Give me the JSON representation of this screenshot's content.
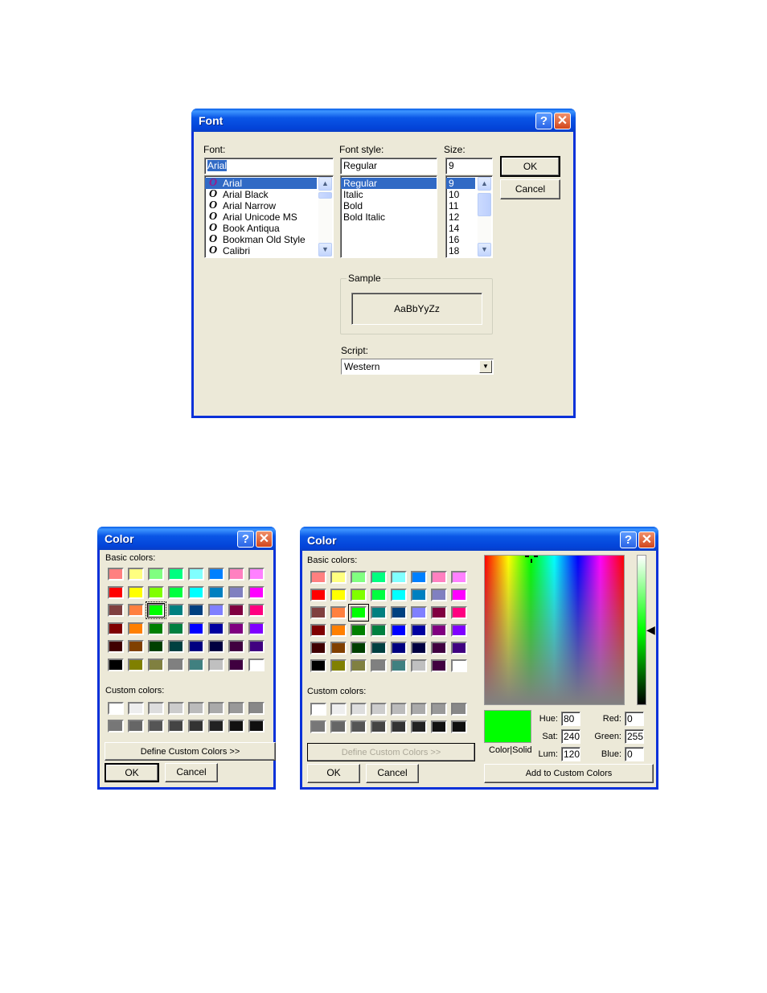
{
  "font_dialog": {
    "title": "Font",
    "help_label": "?",
    "close_label": "✕",
    "font_label": "Font:",
    "font_value": "Arial",
    "font_list": [
      "Arial",
      "Arial Black",
      "Arial Narrow",
      "Arial Unicode MS",
      "Book Antiqua",
      "Bookman Old Style",
      "Calibri"
    ],
    "font_selected": "Arial",
    "font_icon_glyph": "O",
    "style_label": "Font style:",
    "style_value": "Regular",
    "style_list": [
      "Regular",
      "Italic",
      "Bold",
      "Bold Italic"
    ],
    "style_selected": "Regular",
    "size_label": "Size:",
    "size_value": "9",
    "size_list": [
      "9",
      "10",
      "11",
      "12",
      "14",
      "16",
      "18"
    ],
    "size_selected": "9",
    "ok_label": "OK",
    "cancel_label": "Cancel",
    "sample_label": "Sample",
    "sample_text": "AaBbYyZz",
    "script_label": "Script:",
    "script_value": "Western",
    "scroll_up_glyph": "▲",
    "scroll_down_glyph": "▼",
    "dropdown_glyph": "▼"
  },
  "basic_colors": [
    "#ff8080",
    "#ffff80",
    "#80ff80",
    "#00ff80",
    "#80ffff",
    "#0080ff",
    "#ff80c0",
    "#ff80ff",
    "#ff0000",
    "#ffff00",
    "#80ff00",
    "#00ff40",
    "#00ffff",
    "#0080c0",
    "#8080c0",
    "#ff00ff",
    "#804040",
    "#ff8040",
    "#00ff00",
    "#008080",
    "#004080",
    "#8080ff",
    "#800040",
    "#ff0080",
    "#800000",
    "#ff8000",
    "#008000",
    "#008040",
    "#0000ff",
    "#0000a0",
    "#800080",
    "#8000ff",
    "#400000",
    "#804000",
    "#004000",
    "#004040",
    "#000080",
    "#000040",
    "#400040",
    "#400080",
    "#000000",
    "#808000",
    "#808040",
    "#808080",
    "#408080",
    "#c0c0c0",
    "#400040",
    "#ffffff"
  ],
  "selected_basic_color_index": 18,
  "custom_colors": [
    "#ffffff",
    "#eeeeee",
    "#dddddd",
    "#cccccc",
    "#bbbbbb",
    "#aaaaaa",
    "#999999",
    "#888888",
    "#777777",
    "#666666",
    "#555555",
    "#444444",
    "#333333",
    "#222222",
    "#111111",
    "#0f0f0f"
  ],
  "color_dialog_small": {
    "title": "Color",
    "help_label": "?",
    "close_label": "✕",
    "basic_colors_label": "Basic colors:",
    "custom_colors_label": "Custom colors:",
    "define_custom_label": "Define Custom Colors >>",
    "ok_label": "OK",
    "cancel_label": "Cancel"
  },
  "color_dialog_full": {
    "title": "Color",
    "help_label": "?",
    "close_label": "✕",
    "basic_colors_label": "Basic colors:",
    "custom_colors_label": "Custom colors:",
    "define_custom_label": "Define Custom Colors >>",
    "define_custom_disabled": true,
    "ok_label": "OK",
    "cancel_label": "Cancel",
    "preview_color": "#00ff00",
    "color_solid_label": "Color|Solid",
    "hue_label": "Hue:",
    "hue_value": "80",
    "sat_label": "Sat:",
    "sat_value": "240",
    "lum_label": "Lum:",
    "lum_value": "120",
    "red_label": "Red:",
    "red_value": "0",
    "green_label": "Green:",
    "green_value": "255",
    "blue_label": "Blue:",
    "blue_value": "0",
    "add_custom_label": "Add to Custom Colors",
    "lum_arrow_glyph": "◀"
  }
}
